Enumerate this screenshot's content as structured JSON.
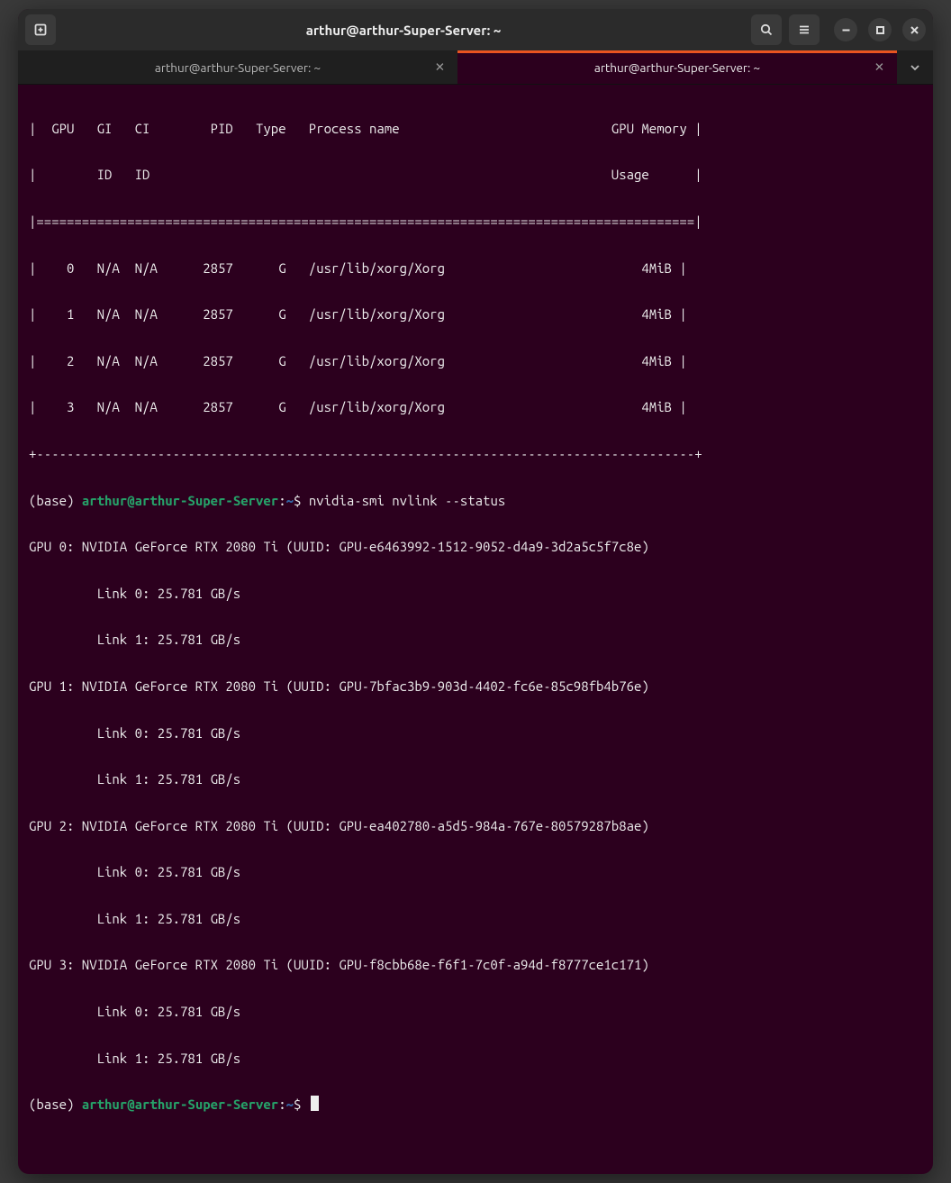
{
  "titlebar": {
    "title": "arthur@arthur-Super-Server: ~"
  },
  "tabs": [
    {
      "label": "arthur@arthur-Super-Server: ~",
      "active": false
    },
    {
      "label": "arthur@arthur-Super-Server: ~",
      "active": true
    }
  ],
  "table": {
    "header1": "|  GPU   GI   CI        PID   Type   Process name                            GPU Memory |",
    "header2": "|        ID   ID                                                             Usage      |",
    "sep": "|=======================================================================================|",
    "rows": [
      "|    0   N/A  N/A      2857      G   /usr/lib/xorg/Xorg                          4MiB |",
      "|    1   N/A  N/A      2857      G   /usr/lib/xorg/Xorg                          4MiB |",
      "|    2   N/A  N/A      2857      G   /usr/lib/xorg/Xorg                          4MiB |",
      "|    3   N/A  N/A      2857      G   /usr/lib/xorg/Xorg                          4MiB |"
    ],
    "footer": "+---------------------------------------------------------------------------------------+"
  },
  "prompt": {
    "env": "(base) ",
    "userhost": "arthur@arthur-Super-Server",
    "colon": ":",
    "path": "~",
    "dollar": "$ ",
    "command": "nvidia-smi nvlink --status"
  },
  "gpus": [
    {
      "head": "GPU 0: NVIDIA GeForce RTX 2080 Ti (UUID: GPU-e6463992-1512-9052-d4a9-3d2a5c5f7c8e)",
      "l0": "         Link 0: 25.781 GB/s",
      "l1": "         Link 1: 25.781 GB/s"
    },
    {
      "head": "GPU 1: NVIDIA GeForce RTX 2080 Ti (UUID: GPU-7bfac3b9-903d-4402-fc6e-85c98fb4b76e)",
      "l0": "         Link 0: 25.781 GB/s",
      "l1": "         Link 1: 25.781 GB/s"
    },
    {
      "head": "GPU 2: NVIDIA GeForce RTX 2080 Ti (UUID: GPU-ea402780-a5d5-984a-767e-80579287b8ae)",
      "l0": "         Link 0: 25.781 GB/s",
      "l1": "         Link 1: 25.781 GB/s"
    },
    {
      "head": "GPU 3: NVIDIA GeForce RTX 2080 Ti (UUID: GPU-f8cbb68e-f6f1-7c0f-a94d-f8777ce1c171)",
      "l0": "         Link 0: 25.781 GB/s",
      "l1": "         Link 1: 25.781 GB/s"
    }
  ]
}
